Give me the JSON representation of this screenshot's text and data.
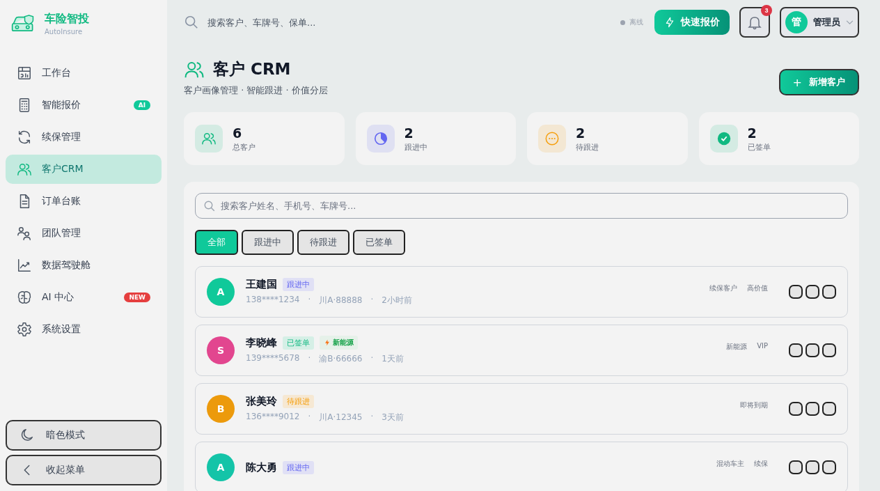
{
  "brand": {
    "name": "车险智投",
    "subtitle": "AutoInsure"
  },
  "sidebar": {
    "items": [
      {
        "label": "工作台",
        "selected": false
      },
      {
        "label": "智能报价",
        "selected": false,
        "badge": {
          "text": "AI",
          "kind": "ai"
        }
      },
      {
        "label": "续保管理",
        "selected": false
      },
      {
        "label": "客户CRM",
        "selected": true
      },
      {
        "label": "订单台账",
        "selected": false
      },
      {
        "label": "团队管理",
        "selected": false
      },
      {
        "label": "数据驾驶舱",
        "selected": false
      },
      {
        "label": "AI 中心",
        "selected": false,
        "badge": {
          "text": "NEW",
          "kind": "new"
        }
      },
      {
        "label": "系统设置",
        "selected": false
      }
    ],
    "footer_buttons": [
      {
        "label": "暗色模式"
      },
      {
        "label": "收起菜单"
      }
    ]
  },
  "topbar": {
    "search_placeholder": "搜索客户、车牌号、保单...",
    "connection": {
      "text": "离线",
      "online": false
    },
    "quick_quote_button": "快速报价",
    "notification_count": "3",
    "user": {
      "avatar": "管",
      "name": "管理员"
    }
  },
  "page": {
    "title": "客户 CRM",
    "subtitle": "客户画像管理 · 智能跟进 · 价值分层",
    "add_button_icon": "+",
    "add_button": "新增客户",
    "meta_separator": "·"
  },
  "stats": [
    {
      "value": "6",
      "label": "总客户",
      "kind": "users",
      "color": "#10b981"
    },
    {
      "value": "2",
      "label": "跟进中",
      "kind": "pie",
      "color": "#6366f1"
    },
    {
      "value": "2",
      "label": "待跟进",
      "kind": "dots",
      "color": "#f59e0b"
    },
    {
      "value": "2",
      "label": "已签单",
      "kind": "check",
      "color": "#10b981"
    }
  ],
  "customer_search": {
    "placeholder": "搜索客户姓名、手机号、车牌号..."
  },
  "filters": [
    {
      "label": "全部",
      "selected": true
    },
    {
      "label": "跟进中",
      "selected": false
    },
    {
      "label": "待跟进",
      "selected": false
    },
    {
      "label": "已签单",
      "selected": false
    }
  ],
  "customers": [
    {
      "avatar": "A",
      "color": "#10c99a",
      "name": "王建国",
      "status": {
        "text": "跟进中",
        "kind": "following"
      },
      "phone": "138****1234",
      "plate": "川A·88888",
      "time": "2小时前",
      "tags": [
        "续保客户",
        "高价值"
      ]
    },
    {
      "avatar": "S",
      "color": "#e2468f",
      "name": "李晓峰",
      "status": {
        "text": "已签单",
        "kind": "signed"
      },
      "extra_tag": "新能源",
      "phone": "139****5678",
      "plate": "渝B·66666",
      "time": "1天前",
      "tags": [
        "新能源",
        "VIP"
      ]
    },
    {
      "avatar": "B",
      "color": "#ec9a0c",
      "name": "张美玲",
      "status": {
        "text": "待跟进",
        "kind": "pending"
      },
      "phone": "136****9012",
      "plate": "川A·12345",
      "time": "3天前",
      "tags": [
        "即将到期"
      ]
    },
    {
      "avatar": "A",
      "color": "#14c4a8",
      "name": "陈大勇",
      "status": {
        "text": "跟进中",
        "kind": "following"
      },
      "tags": [
        "混动车主",
        "续保"
      ]
    }
  ]
}
